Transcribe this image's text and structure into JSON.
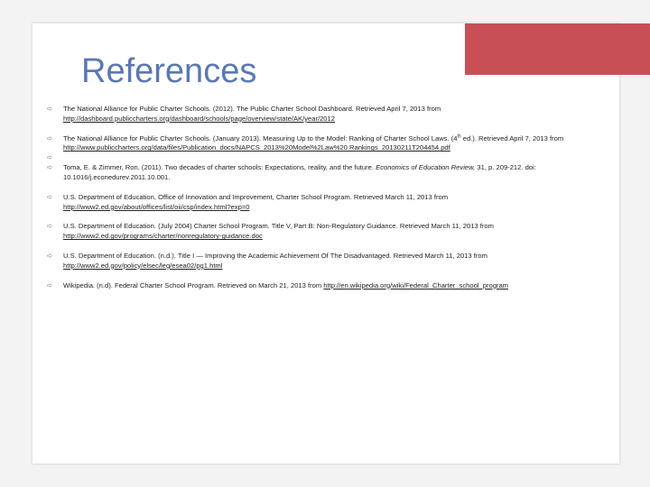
{
  "slide": {
    "title": "References",
    "accent_color": "#c94f57",
    "title_color": "#5a78b2",
    "bullet_icon": "arrow-right-icon"
  },
  "references": [
    {
      "pre": "The National Alliance for Public Charter Schools. (2012). The Public Charter School Dashboard. Retrieved April 7, 2013 from ",
      "link": "http://dashboard.publiccharters.org/dashboard/schools/page/overview/state/AK/year/2012"
    },
    {
      "pre": "The National Alliance for Public Charter Schools. (January 2013). Measuring Up to the Model: Ranking of Charter School Laws. (4",
      "sup": "th",
      "mid": " ed.). Retrieved April 7, 2013 from ",
      "link": "http://www.publiccharters.org/data/files/Publication_docs/NAPCS_2013%20Model%2Law%20 Rankings_20130211T204454.pdf"
    },
    {
      "pre": "Toma, E. & Zimmer, Ron. (2011). Two decades of charter schools: Expectations, reality, and the future. ",
      "italic": "Economics of Education Review,",
      "post": " 31, p. 209-212. doi: 10.1016/j.econedurev.2011.10.001."
    },
    {
      "pre": "U.S. Department of Education, Office of Innovation and Improvement, Charter School Program. Retrieved March 11, 2013 from ",
      "link": "http://www2.ed.gov/about/offices/list/oii/csp/index.html?exp=0"
    },
    {
      "pre": "U.S. Department of Education. (July 2004) Charter School Program. Title V, Part B: Non-Regulatory Guidance. Retrieved March 11, 2013 from ",
      "link": "http://www2.ed.gov/programs/charter/nonregulatory-guidance.doc"
    },
    {
      "pre": "U.S. Department of Education. (n.d.). Title I — Improving the Academic Achievement Of The Disadvantaged. Retrieved March 11, 2013 from ",
      "link": "http://www2.ed.gov/policy/elsec/leg/esea02/pg1.html"
    },
    {
      "pre": "Wikipedia. (n.d). Federal Charter School Program. Retrieved on March 21, 2013 from ",
      "link": "http://en.wikipedia.org/wiki/Federal_Charter_school_program"
    }
  ]
}
